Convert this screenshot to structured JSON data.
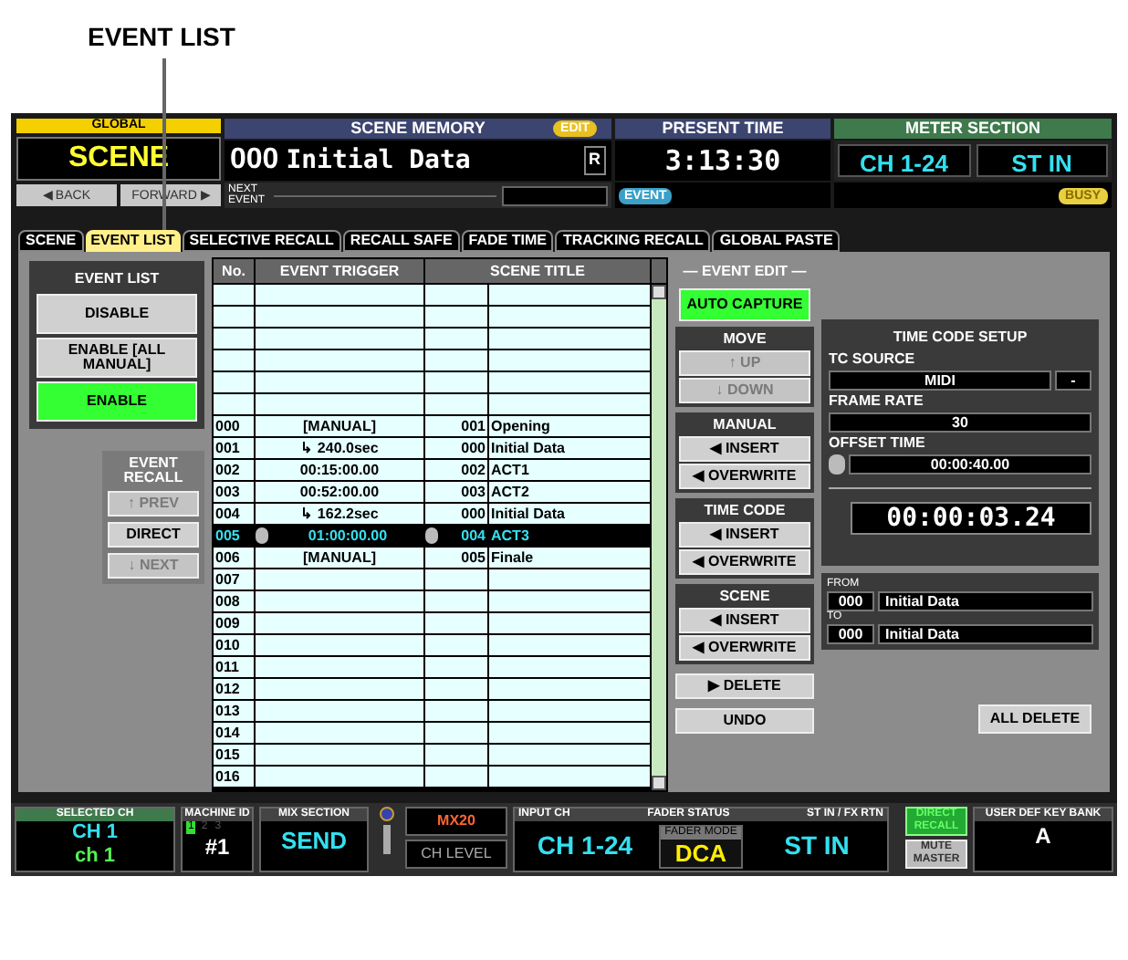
{
  "callout": {
    "label": "EVENT LIST"
  },
  "header": {
    "global": {
      "title": "GLOBAL",
      "value": "SCENE",
      "back": "◀ BACK",
      "forward": "FORWARD ▶"
    },
    "scene_memory": {
      "title": "SCENE MEMORY",
      "badge": "EDIT",
      "number": "000",
      "name": "Initial Data",
      "flag": "R",
      "next_label": "NEXT EVENT"
    },
    "present_time": {
      "title": "PRESENT TIME",
      "time": "3:13:30",
      "badge": "EVENT"
    },
    "meter_section": {
      "title": "METER SECTION",
      "left": "CH 1-24",
      "right": "ST IN",
      "badge": "BUSY"
    }
  },
  "tabs": [
    {
      "label": "SCENE",
      "selected": false
    },
    {
      "label": "EVENT LIST",
      "selected": true
    },
    {
      "label": "SELECTIVE RECALL",
      "selected": false
    },
    {
      "label": "RECALL SAFE",
      "selected": false
    },
    {
      "label": "FADE TIME",
      "selected": false
    },
    {
      "label": "TRACKING RECALL",
      "selected": false
    },
    {
      "label": "GLOBAL PASTE",
      "selected": false
    }
  ],
  "event_list": {
    "title": "EVENT LIST",
    "options": [
      {
        "label": "DISABLE",
        "selected": false
      },
      {
        "label": "ENABLE [ALL MANUAL]",
        "selected": false
      },
      {
        "label": "ENABLE",
        "selected": true
      }
    ]
  },
  "event_recall": {
    "title": "EVENT RECALL",
    "buttons": [
      {
        "label": "↑ PREV",
        "disabled": true
      },
      {
        "label": "DIRECT",
        "disabled": false
      },
      {
        "label": "↓ NEXT",
        "disabled": true
      }
    ]
  },
  "table": {
    "columns": [
      "No.",
      "EVENT TRIGGER",
      "SCENE TITLE"
    ],
    "rows": [
      {
        "kind": "empty"
      },
      {
        "kind": "empty"
      },
      {
        "kind": "empty"
      },
      {
        "kind": "empty"
      },
      {
        "kind": "empty"
      },
      {
        "kind": "empty"
      },
      {
        "kind": "event",
        "no": "000",
        "trigger": "[MANUAL]",
        "scene_no": "001",
        "scene_title": "Opening",
        "selected": false
      },
      {
        "kind": "event",
        "no": "001",
        "trigger": "↳ 240.0sec",
        "scene_no": "000",
        "scene_title": "Initial Data",
        "selected": false
      },
      {
        "kind": "event",
        "no": "002",
        "trigger": "00:15:00.00",
        "scene_no": "002",
        "scene_title": "ACT1",
        "selected": false
      },
      {
        "kind": "event",
        "no": "003",
        "trigger": "00:52:00.00",
        "scene_no": "003",
        "scene_title": "ACT2",
        "selected": false
      },
      {
        "kind": "event",
        "no": "004",
        "trigger": "↳ 162.2sec",
        "scene_no": "000",
        "scene_title": "Initial Data",
        "selected": false
      },
      {
        "kind": "event",
        "no": "005",
        "trigger": "01:00:00.00",
        "scene_no": "004",
        "scene_title": "ACT3",
        "selected": true
      },
      {
        "kind": "event",
        "no": "006",
        "trigger": "[MANUAL]",
        "scene_no": "005",
        "scene_title": "Finale",
        "selected": false
      },
      {
        "kind": "event",
        "no": "007",
        "selected": false
      },
      {
        "kind": "event",
        "no": "008",
        "selected": false
      },
      {
        "kind": "event",
        "no": "009",
        "selected": false
      },
      {
        "kind": "event",
        "no": "010",
        "selected": false
      },
      {
        "kind": "event",
        "no": "011",
        "selected": false
      },
      {
        "kind": "event",
        "no": "012",
        "selected": false
      },
      {
        "kind": "event",
        "no": "013",
        "selected": false
      },
      {
        "kind": "event",
        "no": "014",
        "selected": false
      },
      {
        "kind": "event",
        "no": "015",
        "selected": false
      },
      {
        "kind": "event",
        "no": "016",
        "selected": false
      }
    ]
  },
  "event_edit": {
    "title": "— EVENT EDIT —",
    "auto_capture": {
      "label": "AUTO CAPTURE",
      "on": true
    },
    "groups": [
      {
        "title": "MOVE",
        "buttons": [
          {
            "label": "↑ UP",
            "disabled": true
          },
          {
            "label": "↓ DOWN",
            "disabled": true
          }
        ]
      },
      {
        "title": "MANUAL",
        "buttons": [
          {
            "label": "◀ INSERT",
            "disabled": false
          },
          {
            "label": "◀ OVERWRITE",
            "disabled": false
          }
        ]
      },
      {
        "title": "TIME CODE",
        "buttons": [
          {
            "label": "◀ INSERT",
            "disabled": false
          },
          {
            "label": "◀ OVERWRITE",
            "disabled": false
          }
        ]
      },
      {
        "title": "SCENE",
        "buttons": [
          {
            "label": "◀ INSERT",
            "disabled": false
          },
          {
            "label": "◀ OVERWRITE",
            "disabled": false
          }
        ]
      }
    ],
    "delete": "▶ DELETE",
    "undo": "UNDO"
  },
  "time_code_setup": {
    "title": "TIME CODE SETUP",
    "tc_source_label": "TC SOURCE",
    "tc_source": "MIDI",
    "tc_port": "-",
    "frame_rate_label": "FRAME RATE",
    "frame_rate": "30",
    "offset_label": "OFFSET TIME",
    "offset": "00:00:40.00",
    "display": "00:00:03.24"
  },
  "scene_range": {
    "from_label": "FROM",
    "from_no": "000",
    "from_title": "Initial Data",
    "to_label": "TO",
    "to_no": "000",
    "to_title": "Initial Data"
  },
  "all_delete": "ALL DELETE",
  "status_bar": {
    "selected_ch": {
      "title": "SELECTED CH",
      "ch": "CH 1",
      "name": "ch 1"
    },
    "machine_id": {
      "title": "MACHINE ID",
      "ids": [
        {
          "label": "1",
          "selected": true
        },
        {
          "label": "2",
          "selected": false
        },
        {
          "label": "3",
          "selected": false
        }
      ],
      "value": "#1"
    },
    "mix_section": {
      "title": "MIX SECTION",
      "value": "SEND",
      "bus": "MX20",
      "mode": "CH LEVEL"
    },
    "fader_status": {
      "input_label": "INPUT CH",
      "title": "FADER STATUS",
      "stin_label": "ST IN / FX RTN",
      "input": "CH 1-24",
      "mode_label": "FADER MODE",
      "mode": "DCA",
      "stin": "ST IN"
    },
    "direct_recall": {
      "label": "DIRECT RECALL",
      "on": true
    },
    "mute_master": {
      "label": "MUTE MASTER",
      "on": false
    },
    "key_bank": {
      "title": "USER DEF KEY BANK",
      "value": "A"
    }
  }
}
